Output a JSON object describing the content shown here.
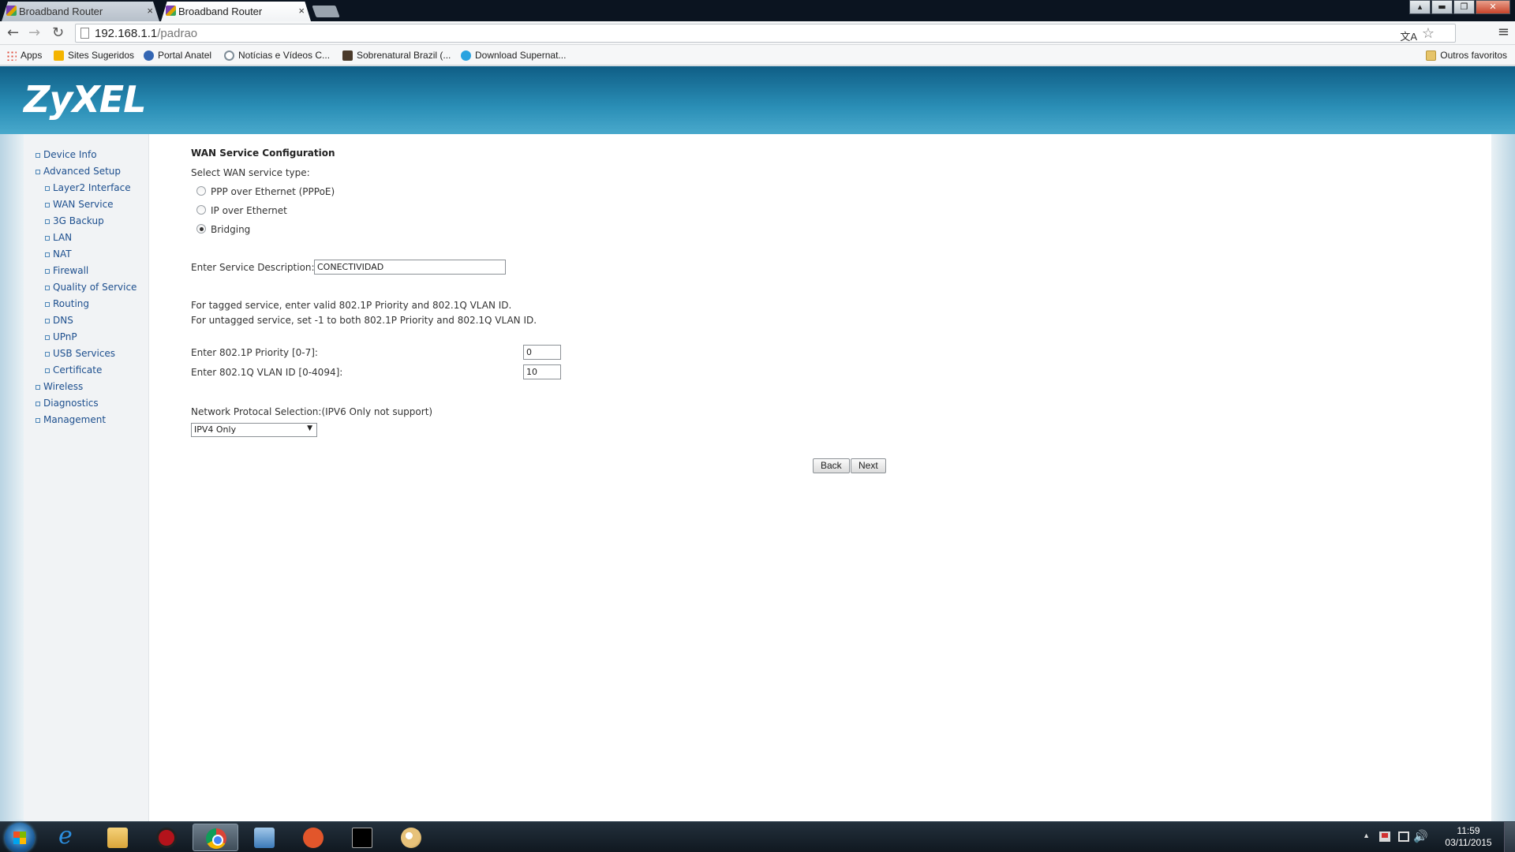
{
  "browser": {
    "tabs": [
      {
        "label": "Broadband Router"
      },
      {
        "label": "Broadband Router"
      }
    ],
    "tab_close_glyph": "×",
    "url_host": "192.168.1.1",
    "url_path": "/padrao",
    "bookmarks": [
      {
        "label": "Apps"
      },
      {
        "label": "Sites Sugeridos"
      },
      {
        "label": "Portal Anatel"
      },
      {
        "label": "Notícias e Vídeos C..."
      },
      {
        "label": "Sobrenatural Brazil (..."
      },
      {
        "label": "Download Supernat..."
      }
    ],
    "other_bookmarks": "Outros favoritos",
    "window_buttons": {
      "up": "▴",
      "minimize": "▬",
      "restore": "❐",
      "close": "✕"
    },
    "nav_glyphs": {
      "back": "←",
      "forward": "→",
      "reload": "↻",
      "star": "☆",
      "menu": "≡",
      "translate": "文A"
    }
  },
  "router": {
    "logo": "ZyXEL",
    "sidebar": [
      {
        "label": "Device Info",
        "level": 1
      },
      {
        "label": "Advanced Setup",
        "level": 1
      },
      {
        "label": "Layer2 Interface",
        "level": 2
      },
      {
        "label": "WAN Service",
        "level": 2
      },
      {
        "label": "3G Backup",
        "level": 2
      },
      {
        "label": "LAN",
        "level": 2
      },
      {
        "label": "NAT",
        "level": 2
      },
      {
        "label": "Firewall",
        "level": 2
      },
      {
        "label": "Quality of Service",
        "level": 2
      },
      {
        "label": "Routing",
        "level": 2
      },
      {
        "label": "DNS",
        "level": 2
      },
      {
        "label": "UPnP",
        "level": 2
      },
      {
        "label": "USB Services",
        "level": 2
      },
      {
        "label": "Certificate",
        "level": 2
      },
      {
        "label": "Wireless",
        "level": 1
      },
      {
        "label": "Diagnostics",
        "level": 1
      },
      {
        "label": "Management",
        "level": 1
      }
    ],
    "form": {
      "title": "WAN Service Configuration",
      "service_type_label": "Select WAN service type:",
      "service_types": [
        {
          "label": "PPP over Ethernet (PPPoE)",
          "checked": false
        },
        {
          "label": "IP over Ethernet",
          "checked": false
        },
        {
          "label": "Bridging",
          "checked": true
        }
      ],
      "description_label": "Enter Service Description:",
      "description_value": "CONECTIVIDAD",
      "tagged_note": "For tagged service, enter valid 802.1P Priority and 802.1Q VLAN ID.",
      "untagged_note": "For untagged service, set -1 to both 802.1P Priority and 802.1Q VLAN ID.",
      "priority_label": "Enter 802.1P Priority [0-7]:",
      "priority_value": "0",
      "vlan_label": "Enter 802.1Q VLAN ID [0-4094]:",
      "vlan_value": "10",
      "protocol_label": "Network Protocal Selection:(IPV6 Only not support)",
      "protocol_value": "IPV4 Only",
      "back_label": "Back",
      "next_label": "Next"
    }
  },
  "taskbar": {
    "apps": [
      "internet-explorer-icon",
      "file-explorer-icon",
      "tool-icon",
      "chrome-icon",
      "remote-desktop-icon",
      "media-player-icon",
      "command-prompt-icon",
      "paint-icon"
    ],
    "active_app": "chrome-icon",
    "ie_glyph": "e",
    "time": "11:59",
    "date": "03/11/2015",
    "tray_glyphs": {
      "arrow": "▲",
      "volume": "🔊"
    }
  }
}
